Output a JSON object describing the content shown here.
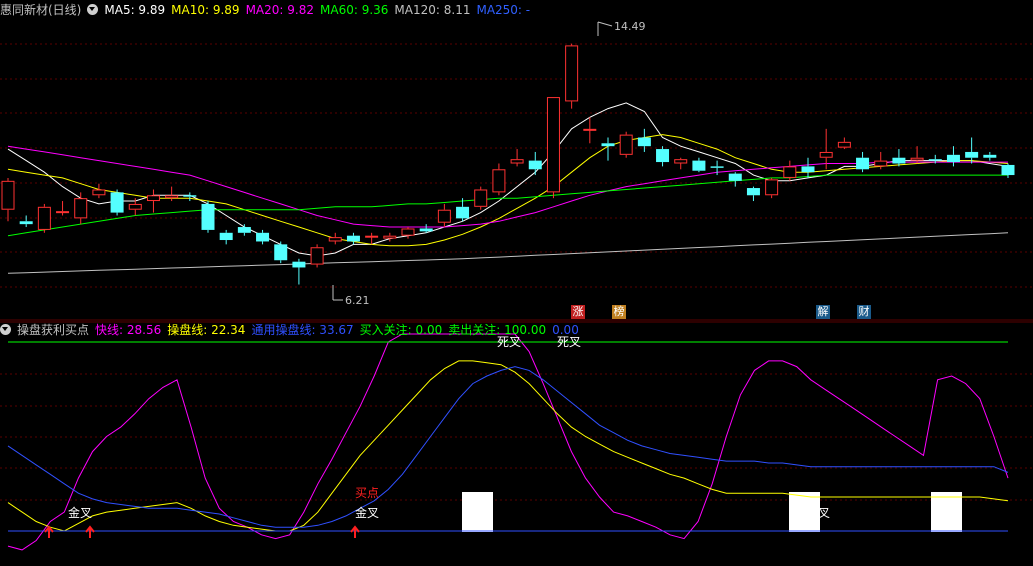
{
  "upper": {
    "title": "惠同新材(日线)",
    "ma": [
      {
        "label": "MA5: 9.89",
        "color": "#ffffff"
      },
      {
        "label": "MA10: 9.89",
        "color": "#ffff00"
      },
      {
        "label": "MA20: 9.82",
        "color": "#ff00ff"
      },
      {
        "label": "MA60: 9.36",
        "color": "#00ff00"
      },
      {
        "label": "MA120: 8.11",
        "color": "#c0c0c0"
      },
      {
        "label": "MA250: -",
        "color": "#3060ff"
      }
    ],
    "high_label": "14.49",
    "low_label": "6.21",
    "badges": [
      {
        "text": "涨",
        "bg": "#c02020"
      },
      {
        "text": "榜",
        "bg": "#c08020"
      },
      {
        "text": "解",
        "bg": "#1a5a8a"
      },
      {
        "text": "财",
        "bg": "#1a5a8a"
      }
    ]
  },
  "lower": {
    "title": "操盘获利买点",
    "items": [
      {
        "label": "快线: 28.56",
        "color": "#ff00ff"
      },
      {
        "label": "操盘线: 22.34",
        "color": "#ffff00"
      },
      {
        "label": "通用操盘线: 33.67",
        "color": "#3050ff"
      },
      {
        "label": "买入关注: 0.00",
        "color": "#00ff00"
      },
      {
        "label": "卖出关注: 100.00",
        "color": "#00ff00"
      },
      {
        "label": "0.00",
        "color": "#3050ff"
      }
    ],
    "annotations": [
      {
        "text": "金叉",
        "color": "#ffffff"
      },
      {
        "text": "金叉",
        "color": "#ffffff"
      },
      {
        "text": "买点",
        "color": "#ff2020"
      },
      {
        "text": "死叉",
        "color": "#ffffff"
      },
      {
        "text": "死叉",
        "color": "#ffffff"
      },
      {
        "text": "叉",
        "color": "#ffffff"
      }
    ]
  },
  "chart_data": [
    {
      "type": "candlestick",
      "ylim": [
        5.5,
        15.3
      ],
      "up_color": "#ff3232",
      "down_color": "#54ffff",
      "candles": [
        [
          8.8,
          9.8,
          8.4,
          9.9
        ],
        [
          8.4,
          8.3,
          8.2,
          8.6
        ],
        [
          8.1,
          8.9,
          8.0,
          9.0
        ],
        [
          8.7,
          8.75,
          8.6,
          9.1
        ],
        [
          8.5,
          9.2,
          8.3,
          9.4
        ],
        [
          9.3,
          9.5,
          9.2,
          9.7
        ],
        [
          9.4,
          8.7,
          8.6,
          9.5
        ],
        [
          8.8,
          9.0,
          8.6,
          9.2
        ],
        [
          9.1,
          9.3,
          8.7,
          9.5
        ],
        [
          9.2,
          9.3,
          9.1,
          9.6
        ],
        [
          9.3,
          9.25,
          9.1,
          9.4
        ],
        [
          9.0,
          8.1,
          8.0,
          9.1
        ],
        [
          8.0,
          7.75,
          7.6,
          8.1
        ],
        [
          8.2,
          8.0,
          7.9,
          8.3
        ],
        [
          8.0,
          7.7,
          7.6,
          8.1
        ],
        [
          7.6,
          7.05,
          6.95,
          7.7
        ],
        [
          7.0,
          6.8,
          6.21,
          7.1
        ],
        [
          6.9,
          7.5,
          6.8,
          7.6
        ],
        [
          7.7,
          7.85,
          7.6,
          8.0
        ],
        [
          7.9,
          7.7,
          7.6,
          8.0
        ],
        [
          7.9,
          7.9,
          7.6,
          8.0
        ],
        [
          7.8,
          7.9,
          7.7,
          8.0
        ],
        [
          7.9,
          8.15,
          7.8,
          8.2
        ],
        [
          8.15,
          8.05,
          8.0,
          8.3
        ],
        [
          8.35,
          8.8,
          8.2,
          9.0
        ],
        [
          8.9,
          8.5,
          8.4,
          9.2
        ],
        [
          8.9,
          9.5,
          8.8,
          9.6
        ],
        [
          9.4,
          10.2,
          9.3,
          10.4
        ],
        [
          10.4,
          10.55,
          10.3,
          10.9
        ],
        [
          10.5,
          10.2,
          10.0,
          10.8
        ],
        [
          9.4,
          12.7,
          9.2,
          12.7
        ],
        [
          12.55,
          14.49,
          12.3,
          14.55
        ],
        [
          11.6,
          11.6,
          11.1,
          12.0
        ],
        [
          11.1,
          11.0,
          10.5,
          11.3
        ],
        [
          10.7,
          11.4,
          10.6,
          11.5
        ],
        [
          11.3,
          11.0,
          10.8,
          11.6
        ],
        [
          10.9,
          10.45,
          10.3,
          11.0
        ],
        [
          10.4,
          10.55,
          10.2,
          10.6
        ],
        [
          10.5,
          10.15,
          10.1,
          10.6
        ],
        [
          10.3,
          10.25,
          10.0,
          10.5
        ],
        [
          10.05,
          9.8,
          9.6,
          10.1
        ],
        [
          9.55,
          9.3,
          9.1,
          9.6
        ],
        [
          9.3,
          9.85,
          9.2,
          9.9
        ],
        [
          9.9,
          10.3,
          9.8,
          10.5
        ],
        [
          10.3,
          10.1,
          9.9,
          10.6
        ],
        [
          10.6,
          10.8,
          10.2,
          11.6
        ],
        [
          10.95,
          11.15,
          10.9,
          11.3
        ],
        [
          10.6,
          10.2,
          10.1,
          10.8
        ],
        [
          10.3,
          10.5,
          10.2,
          10.8
        ],
        [
          10.6,
          10.4,
          10.3,
          10.9
        ],
        [
          10.5,
          10.6,
          10.4,
          11.0
        ],
        [
          10.55,
          10.5,
          10.4,
          10.7
        ],
        [
          10.7,
          10.45,
          10.3,
          11.0
        ],
        [
          10.8,
          10.6,
          10.4,
          11.3
        ],
        [
          10.7,
          10.6,
          10.5,
          10.8
        ],
        [
          10.35,
          10.0,
          9.9,
          10.4
        ]
      ],
      "series": [
        {
          "name": "MA5",
          "color": "#ffffff",
          "values": [
            10.9,
            10.5,
            10.1,
            9.6,
            9.2,
            9.0,
            9.1,
            9.1,
            9.3,
            9.3,
            9.3,
            9.0,
            8.6,
            8.2,
            7.9,
            7.6,
            7.3,
            7.2,
            7.3,
            7.6,
            7.6,
            7.8,
            7.9,
            8.0,
            8.2,
            8.4,
            8.7,
            9.1,
            9.6,
            10.1,
            10.8,
            11.6,
            12.0,
            12.3,
            12.5,
            12.2,
            11.3,
            11.0,
            10.8,
            10.6,
            10.4,
            10.0,
            9.8,
            9.8,
            9.9,
            10.0,
            10.3,
            10.3,
            10.4,
            10.5,
            10.5,
            10.5,
            10.5,
            10.5,
            10.4,
            10.3
          ]
        },
        {
          "name": "MA10",
          "color": "#ffff00",
          "values": [
            10.2,
            10.1,
            10.0,
            9.9,
            9.7,
            9.5,
            9.4,
            9.3,
            9.2,
            9.2,
            9.2,
            9.1,
            9.0,
            8.8,
            8.6,
            8.4,
            8.2,
            8.0,
            7.8,
            7.7,
            7.6,
            7.55,
            7.55,
            7.6,
            7.75,
            7.95,
            8.2,
            8.5,
            8.85,
            9.2,
            9.6,
            10.1,
            10.6,
            11.0,
            11.2,
            11.3,
            11.4,
            11.3,
            11.1,
            10.9,
            10.6,
            10.4,
            10.2,
            10.1,
            10.1,
            10.15,
            10.2,
            10.25,
            10.3,
            10.35,
            10.4,
            10.45,
            10.5,
            10.5,
            10.45,
            10.4
          ]
        },
        {
          "name": "MA20",
          "color": "#ff00ff",
          "values": [
            11.0,
            10.9,
            10.8,
            10.7,
            10.6,
            10.5,
            10.4,
            10.3,
            10.2,
            10.1,
            10.0,
            9.8,
            9.6,
            9.4,
            9.2,
            9.0,
            8.8,
            8.6,
            8.45,
            8.3,
            8.25,
            8.2,
            8.2,
            8.2,
            8.2,
            8.25,
            8.3,
            8.4,
            8.55,
            8.7,
            8.9,
            9.1,
            9.3,
            9.45,
            9.6,
            9.7,
            9.8,
            9.9,
            10.0,
            10.1,
            10.15,
            10.2,
            10.25,
            10.3,
            10.35,
            10.4,
            10.4,
            10.4,
            10.45,
            10.45,
            10.45,
            10.45,
            10.45,
            10.45,
            10.45,
            10.45
          ]
        },
        {
          "name": "MA60",
          "color": "#00ff00",
          "values": [
            7.9,
            8.0,
            8.1,
            8.2,
            8.3,
            8.4,
            8.5,
            8.6,
            8.65,
            8.7,
            8.75,
            8.8,
            8.8,
            8.8,
            8.8,
            8.8,
            8.8,
            8.85,
            8.9,
            8.9,
            8.9,
            8.95,
            9.0,
            9.0,
            9.05,
            9.1,
            9.15,
            9.2,
            9.2,
            9.25,
            9.3,
            9.35,
            9.4,
            9.45,
            9.5,
            9.55,
            9.6,
            9.65,
            9.7,
            9.75,
            9.8,
            9.85,
            9.9,
            9.9,
            9.95,
            10.0,
            10.0,
            10.0,
            10.0,
            10.0,
            10.0,
            10.0,
            10.0,
            10.0,
            10.0,
            10.0
          ]
        },
        {
          "name": "MA120",
          "color": "#c0c0c0",
          "values": [
            6.6,
            6.62,
            6.64,
            6.66,
            6.68,
            6.7,
            6.72,
            6.74,
            6.76,
            6.78,
            6.8,
            6.82,
            6.84,
            6.86,
            6.88,
            6.9,
            6.92,
            6.94,
            6.96,
            6.98,
            7.0,
            7.02,
            7.04,
            7.06,
            7.08,
            7.1,
            7.13,
            7.16,
            7.19,
            7.22,
            7.25,
            7.28,
            7.31,
            7.34,
            7.37,
            7.4,
            7.43,
            7.46,
            7.49,
            7.52,
            7.55,
            7.58,
            7.61,
            7.64,
            7.67,
            7.7,
            7.73,
            7.76,
            7.79,
            7.82,
            7.85,
            7.88,
            7.91,
            7.94,
            7.97,
            8.0
          ]
        }
      ]
    },
    {
      "type": "line",
      "ylim": [
        -12,
        122
      ],
      "series": [
        {
          "name": "快线",
          "color": "#ff00ff",
          "values": [
            -8,
            -10,
            -5,
            5,
            10,
            28,
            42,
            50,
            55,
            62,
            70,
            76,
            80,
            55,
            28,
            12,
            5,
            2,
            -2,
            -4,
            -2,
            10,
            25,
            38,
            52,
            66,
            82,
            100,
            112,
            120,
            122,
            120,
            120,
            119,
            117,
            118,
            110,
            95,
            78,
            60,
            42,
            28,
            18,
            10,
            8,
            5,
            2,
            -2,
            -4,
            5,
            25,
            50,
            72,
            85,
            90,
            90,
            87,
            80,
            75,
            70,
            65,
            60,
            55,
            50,
            45,
            40,
            80,
            82,
            78,
            70,
            50,
            28
          ]
        },
        {
          "name": "操盘线",
          "color": "#ffff00",
          "values": [
            15,
            10,
            5,
            2,
            0,
            4,
            8,
            10,
            11,
            12,
            13,
            14,
            15,
            12,
            8,
            5,
            3,
            2,
            1,
            0,
            0,
            3,
            10,
            20,
            30,
            40,
            48,
            56,
            64,
            72,
            80,
            86,
            90,
            90,
            89,
            88,
            84,
            78,
            70,
            62,
            55,
            50,
            46,
            42,
            39,
            36,
            33,
            30,
            28,
            25,
            22,
            20,
            20,
            20,
            20,
            20,
            19,
            18,
            18,
            18,
            18,
            18,
            18,
            18,
            18,
            18,
            18,
            18,
            18,
            18,
            17,
            16
          ]
        },
        {
          "name": "通用操盘线",
          "color": "#3050ff",
          "values": [
            45,
            40,
            35,
            30,
            25,
            20,
            17,
            15,
            14,
            13,
            12,
            12,
            12,
            11,
            10,
            9,
            7,
            5,
            3,
            2,
            2,
            2,
            3,
            5,
            8,
            12,
            16,
            22,
            30,
            40,
            50,
            60,
            70,
            78,
            82,
            85,
            87,
            85,
            80,
            74,
            68,
            62,
            56,
            52,
            48,
            45,
            43,
            41,
            40,
            39,
            38,
            37,
            37,
            37,
            36,
            36,
            35,
            34,
            34,
            34,
            34,
            34,
            34,
            34,
            34,
            34,
            34,
            34,
            34,
            34,
            34,
            31
          ]
        },
        {
          "name": "买入关注",
          "color": "#3050ff",
          "values": [
            0
          ]
        },
        {
          "name": "卖出关注",
          "color": "#00ff00",
          "values": [
            100
          ]
        }
      ]
    }
  ]
}
